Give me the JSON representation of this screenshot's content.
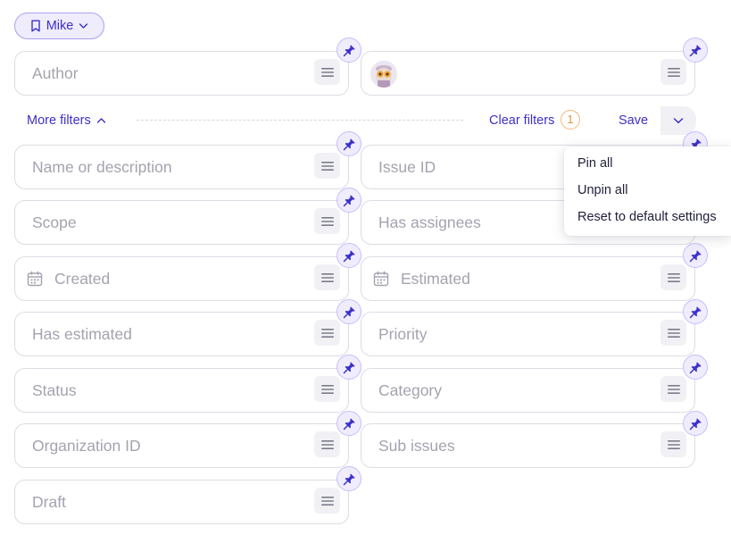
{
  "preset": {
    "label": "Mike",
    "icon": "bookmark-icon"
  },
  "pinned_filters": {
    "author_placeholder": "Author",
    "assignee_avatar": "avatar"
  },
  "more_filters": {
    "label": "More filters"
  },
  "actions": {
    "clear_filters_label": "Clear filters",
    "active_count": "1",
    "save_label": "Save"
  },
  "save_menu": {
    "items": [
      "Pin all",
      "Unpin all",
      "Reset to default settings"
    ]
  },
  "filters": {
    "name_or_description": "Name or description",
    "issue_id": "Issue ID",
    "scope": "Scope",
    "has_assignees": "Has assignees",
    "created": "Created",
    "estimated": "Estimated",
    "has_estimated": "Has estimated",
    "priority": "Priority",
    "status": "Status",
    "category": "Category",
    "organization_id": "Organization ID",
    "sub_issues": "Sub issues",
    "draft": "Draft"
  },
  "colors": {
    "accent": "#3d30c9",
    "chip_bg": "#eeecfd",
    "border": "#dcdce4",
    "placeholder": "#a3a3b1",
    "badge": "#e0922f"
  }
}
